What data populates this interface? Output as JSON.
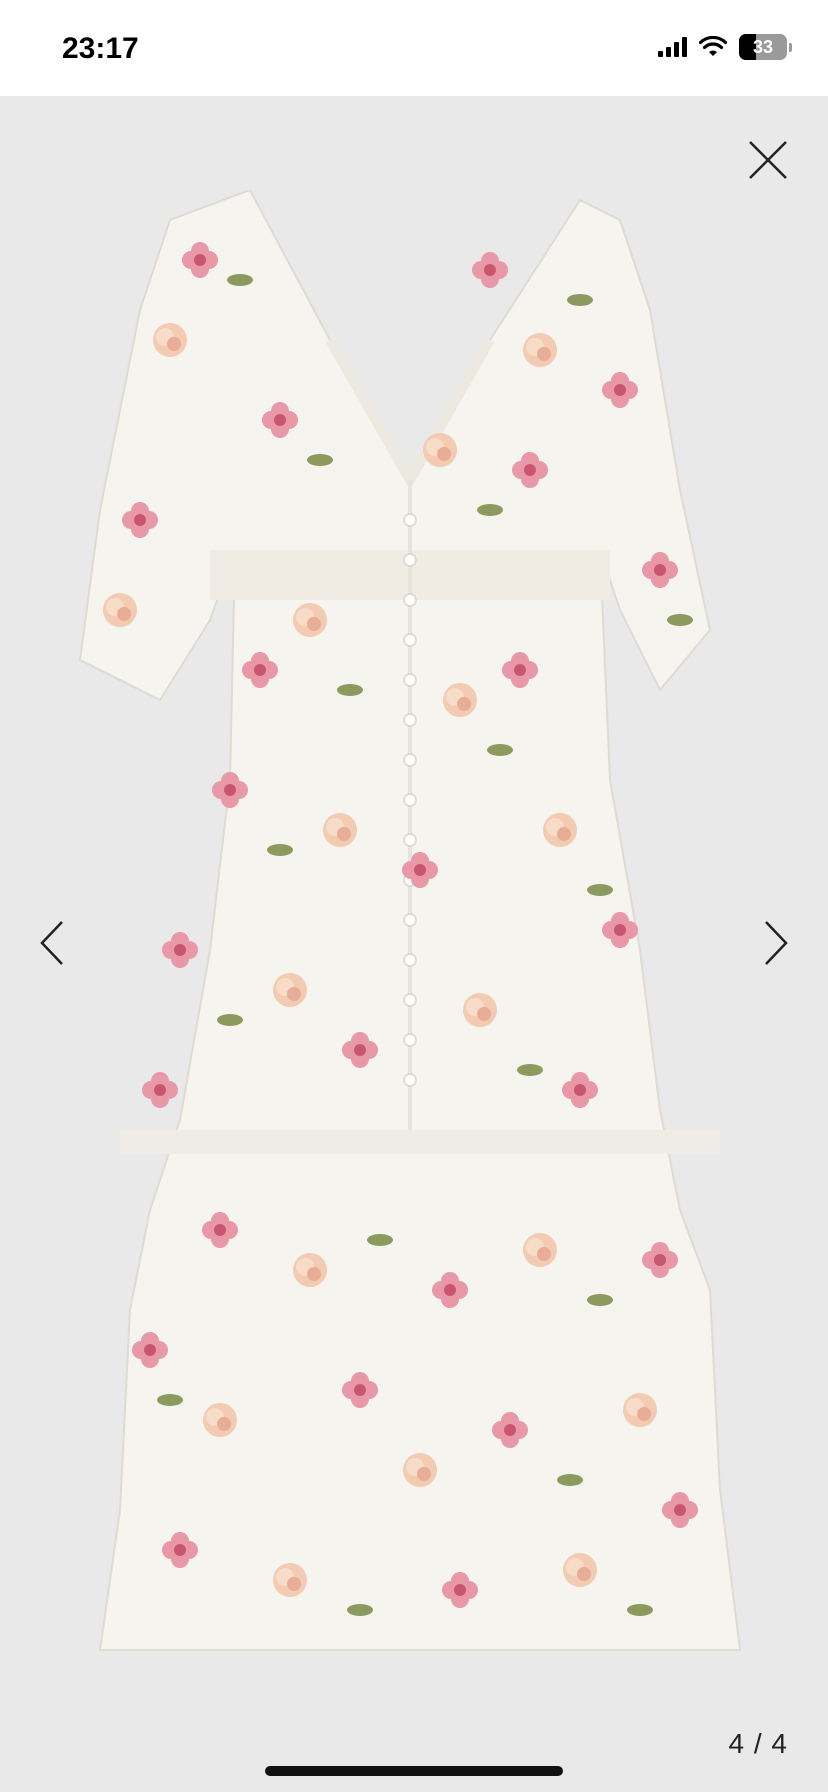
{
  "status_bar": {
    "time": "23:17",
    "battery_level": "33",
    "icons": [
      "signal-icon",
      "wifi-icon",
      "battery-icon"
    ]
  },
  "viewer": {
    "counter": "4 / 4",
    "icons": [
      "close-icon",
      "chevron-left-icon",
      "chevron-right-icon"
    ],
    "product_image_alt": "",
    "colors": {
      "background": "#e9e9ea",
      "dress_base": "#f6f4ef",
      "flower_pink": "#e79aa8",
      "flower_peach": "#f3c9b0",
      "leaf_green": "#8d9a5e"
    }
  }
}
